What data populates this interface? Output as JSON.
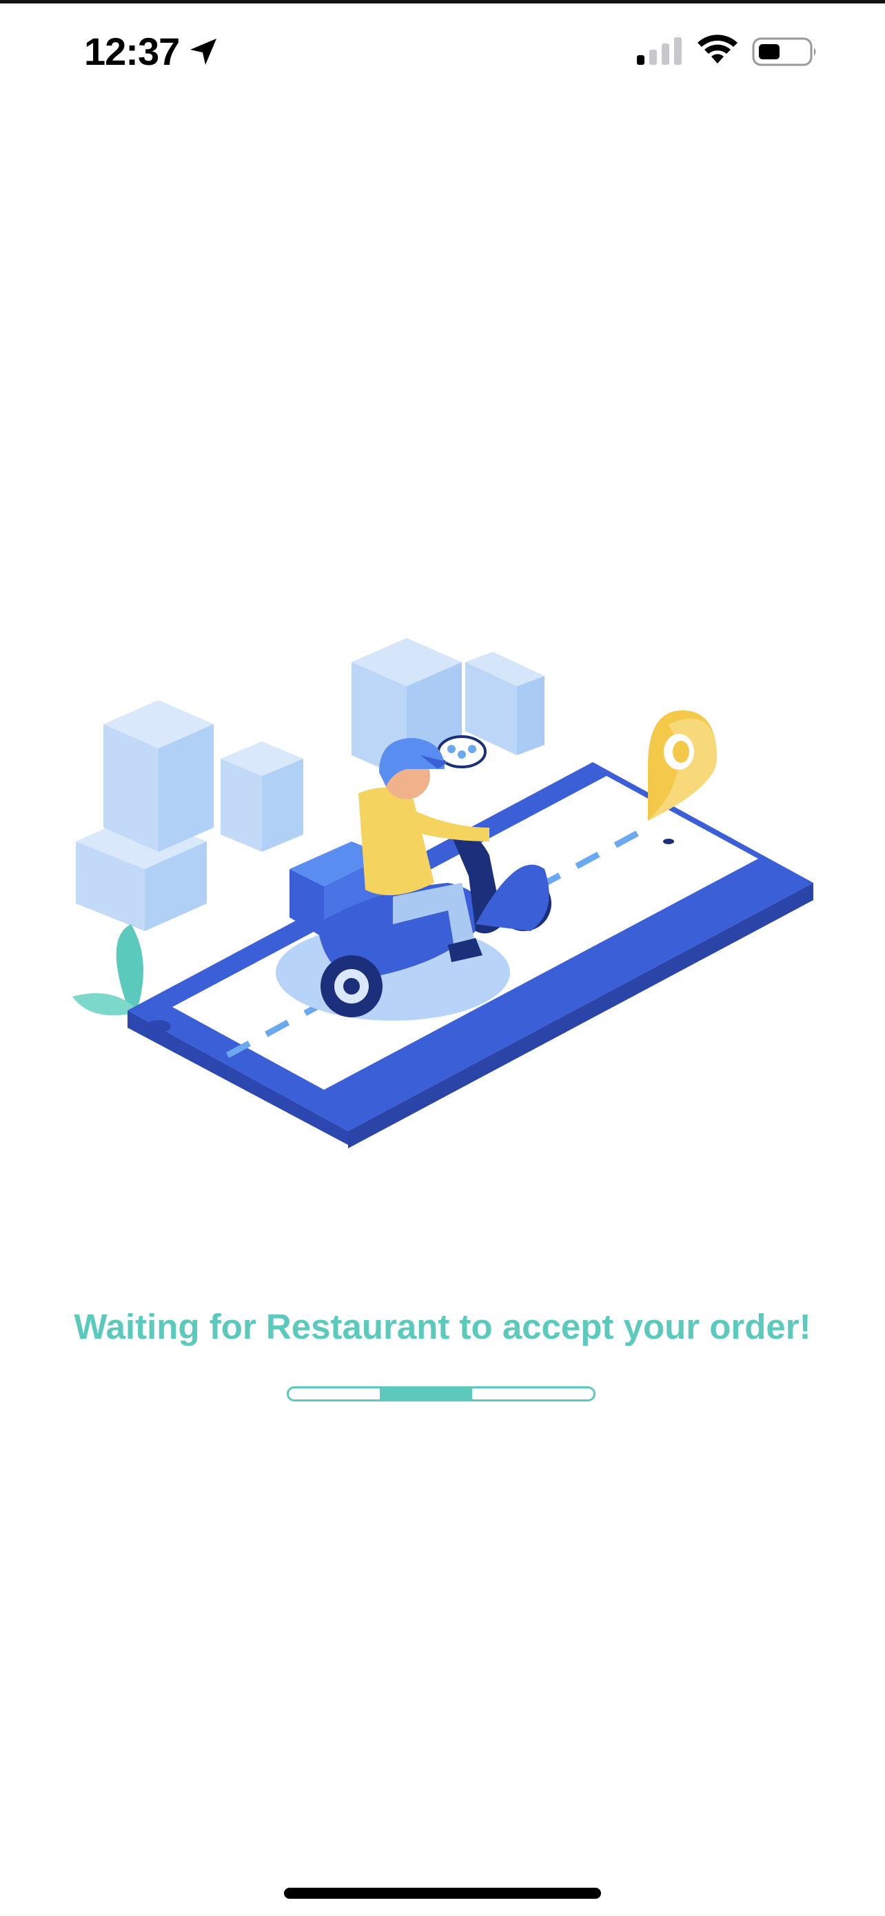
{
  "status_bar": {
    "time": "12:37",
    "icons": [
      "location-arrow-icon",
      "cellular-signal-icon",
      "wifi-icon",
      "battery-icon"
    ]
  },
  "illustration": {
    "subject": "delivery-scooter-on-phone-illustration"
  },
  "order_status": {
    "message": "Waiting for Restaurant to accept your order!"
  },
  "progress": {
    "type": "indeterminate",
    "accent_color": "#5cc9bd"
  },
  "colors": {
    "accent": "#5cc9bd",
    "phone_blue": "#3b5fd6",
    "rider_yellow": "#f4d35e"
  }
}
